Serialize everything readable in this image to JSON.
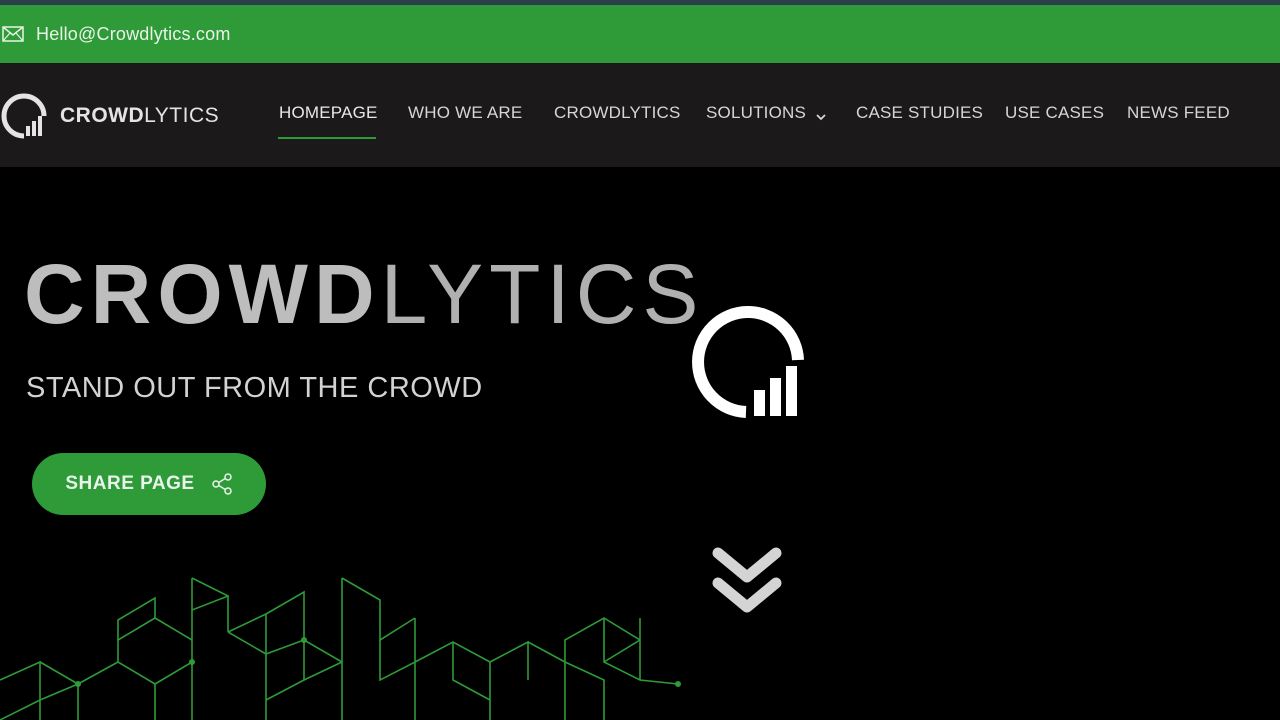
{
  "topbar": {
    "email": "Hello@Crowdlytics.com",
    "icon": "mail-icon"
  },
  "brand": {
    "name_bold": "CROWD",
    "name_light": "LYTICS",
    "logo": "crowdlytics-logo-icon"
  },
  "nav": {
    "items": [
      {
        "label": "HOMEPAGE",
        "active": true
      },
      {
        "label": "WHO WE ARE"
      },
      {
        "label": "CROWDLYTICS"
      },
      {
        "label": "SOLUTIONS",
        "has_dropdown": true
      },
      {
        "label": "CASE STUDIES"
      },
      {
        "label": "USE CASES"
      },
      {
        "label": "NEWS FEED"
      }
    ]
  },
  "hero": {
    "title_bold": "CROWD",
    "title_light": "LYTICS",
    "subtitle": "STAND OUT FROM THE CROWD",
    "share_label": "SHARE PAGE"
  },
  "colors": {
    "accent": "#2e9a38",
    "nav_bg": "#1b191a",
    "page_bg": "#000000"
  }
}
